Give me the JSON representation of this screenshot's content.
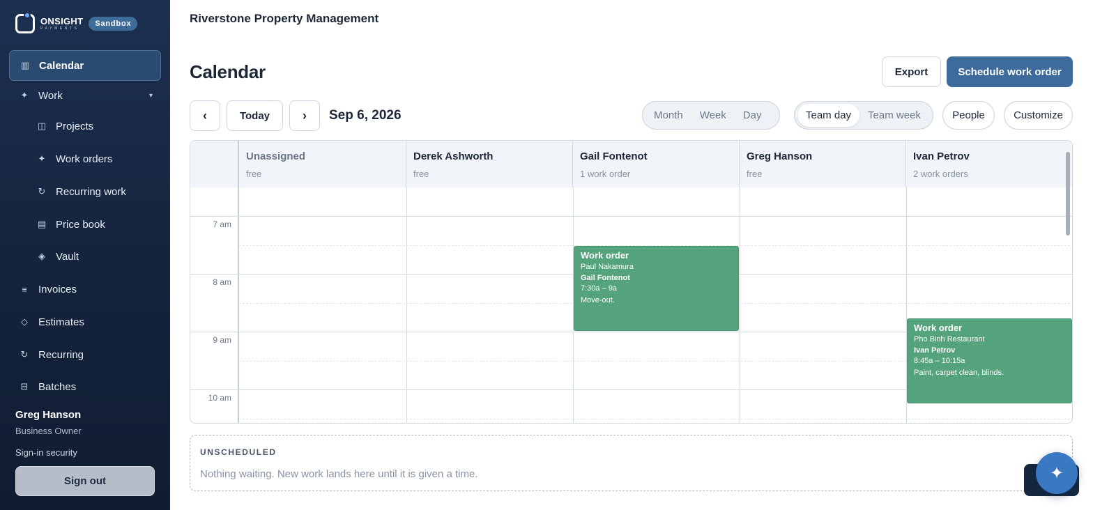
{
  "brand": {
    "name": "ONSIGHT",
    "sub": "PAYMENTS",
    "env_badge": "Sandbox"
  },
  "sidebar": {
    "items": [
      {
        "label": "Calendar",
        "icon": "calendar-icon"
      },
      {
        "label": "Work",
        "icon": "sparkle-icon"
      },
      {
        "label": "Projects",
        "icon": "projects-icon"
      },
      {
        "label": "Work orders",
        "icon": "sparkle-icon"
      },
      {
        "label": "Recurring work",
        "icon": "refresh-icon"
      },
      {
        "label": "Price book",
        "icon": "list-icon"
      },
      {
        "label": "Vault",
        "icon": "diamond-icon"
      },
      {
        "label": "Invoices",
        "icon": "lines-icon"
      },
      {
        "label": "Estimates",
        "icon": "diamond-outline-icon"
      },
      {
        "label": "Recurring",
        "icon": "refresh-icon"
      },
      {
        "label": "Batches",
        "icon": "batch-icon"
      }
    ],
    "user": {
      "name": "Greg Hanson",
      "role": "Business Owner"
    },
    "security_link": "Sign-in security",
    "sign_out": "Sign out"
  },
  "header": {
    "org": "Riverstone Property Management"
  },
  "page": {
    "title": "Calendar",
    "export_label": "Export",
    "schedule_label": "Schedule work order"
  },
  "toolbar": {
    "prev": "‹",
    "today": "Today",
    "next": "›",
    "date": "Sep 6, 2026",
    "views": [
      "Month",
      "Week",
      "Day"
    ],
    "team_views": [
      "Team day",
      "Team week"
    ],
    "team_selected": "Team day",
    "people": "People",
    "customize": "Customize"
  },
  "calendar": {
    "columns": [
      {
        "name": "Unassigned",
        "sub": "free"
      },
      {
        "name": "Derek Ashworth",
        "sub": "free"
      },
      {
        "name": "Gail Fontenot",
        "sub": "1 work order"
      },
      {
        "name": "Greg Hanson",
        "sub": "free"
      },
      {
        "name": "Ivan Petrov",
        "sub": "2 work orders"
      }
    ],
    "hours": [
      "7 am",
      "8 am",
      "9 am",
      "10 am"
    ],
    "events": [
      {
        "title": "Work order",
        "customer": "Paul Nakamura",
        "assignee": "Gail Fontenot",
        "time": "7:30a – 9a",
        "note": "Move-out.",
        "color": "#55a37c"
      },
      {
        "title": "Work order",
        "customer": "Pho Binh Restaurant",
        "assignee": "Ivan Petrov",
        "time": "8:45a – 10:15a",
        "note": "Paint, carpet clean, blinds.",
        "color": "#55a37c"
      }
    ]
  },
  "unscheduled": {
    "title": "UNSCHEDULED",
    "message": "Nothing waiting. New work lands here until it is given a time."
  },
  "colors": {
    "primary": "#3d6b9c",
    "event": "#55a37c",
    "sidebar": "#14233c"
  }
}
